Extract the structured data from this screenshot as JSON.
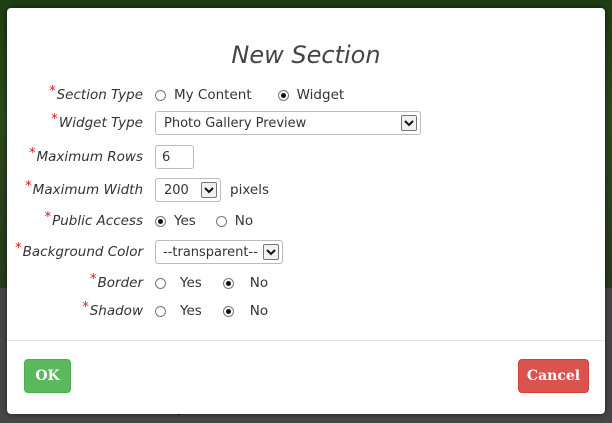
{
  "dialog": {
    "title": "New Section",
    "required_mark": "*",
    "fields": {
      "section_type": {
        "label": "Section Type",
        "options": [
          "My Content",
          "Widget"
        ],
        "selected": "Widget"
      },
      "widget_type": {
        "label": "Widget Type",
        "value": "Photo Gallery Preview"
      },
      "maximum_rows": {
        "label": "Maximum Rows",
        "value": "6"
      },
      "maximum_width": {
        "label": "Maximum Width",
        "value": "200",
        "unit": "pixels"
      },
      "public_access": {
        "label": "Public Access",
        "options": [
          "Yes",
          "No"
        ],
        "selected": "Yes"
      },
      "background_color": {
        "label": "Background Color",
        "value": "--transparent--"
      },
      "border": {
        "label": "Border",
        "options": [
          "Yes",
          "No"
        ],
        "selected": "No"
      },
      "shadow": {
        "label": "Shadow",
        "options": [
          "Yes",
          "No"
        ],
        "selected": "No"
      }
    },
    "buttons": {
      "ok": "OK",
      "cancel": "Cancel"
    }
  },
  "colors": {
    "ok_button": "#5cb85c",
    "cancel_button": "#d9534f",
    "required": "#dd1111"
  }
}
